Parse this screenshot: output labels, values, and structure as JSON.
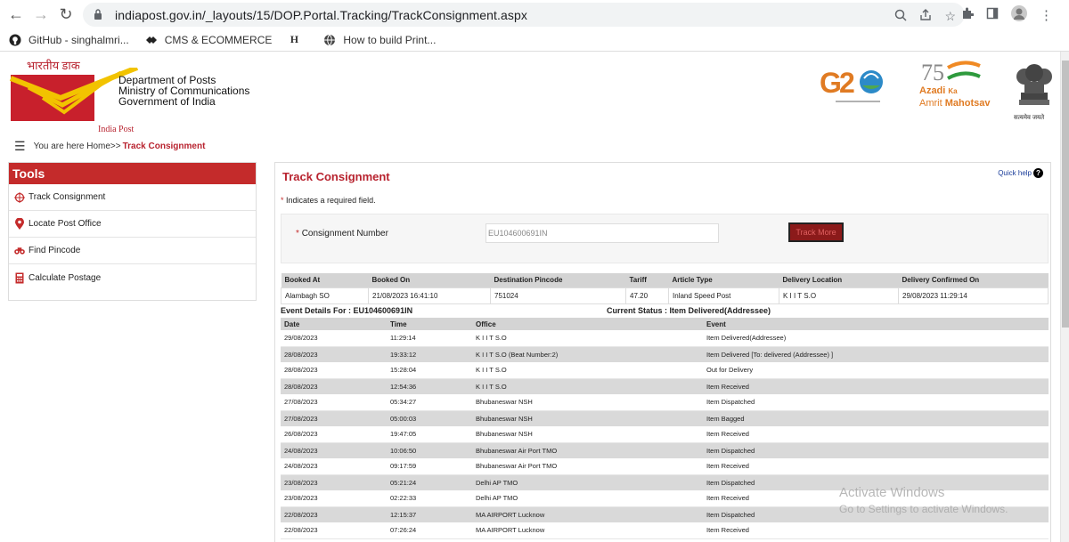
{
  "browser": {
    "url": "indiapost.gov.in/_layouts/15/DOP.Portal.Tracking/TrackConsignment.aspx",
    "bookmarks": [
      {
        "label": "GitHub - singhalmri...",
        "icon": "github-icon"
      },
      {
        "label": "CMS & ECOMMERCE",
        "icon": "bookmark-icon"
      },
      {
        "label": "",
        "icon": "h-icon"
      },
      {
        "label": "How to build Print...",
        "icon": "globe-icon"
      }
    ]
  },
  "header": {
    "logo_hindi": "भारतीय डाक",
    "logo_caption": "India Post",
    "dept_line1": "Department of Posts",
    "dept_line2": "Ministry of Communications",
    "dept_line3": "Government of India",
    "azadi_line1": "Azadi",
    "azadi_line2": "Ka",
    "azadi_line3": "Amrit",
    "azadi_line4": "Mahotsav",
    "emblem_caption": "सत्यमेव जयते"
  },
  "breadcrumb": {
    "prefix": "You are here Home>>",
    "current": "Track Consignment"
  },
  "sidebar": {
    "title": "Tools",
    "items": [
      {
        "label": "Track Consignment",
        "icon": "crosshair-icon"
      },
      {
        "label": "Locate Post Office",
        "icon": "map-pin-icon"
      },
      {
        "label": "Find Pincode",
        "icon": "binoculars-icon"
      },
      {
        "label": "Calculate Postage",
        "icon": "calculator-icon"
      }
    ]
  },
  "main": {
    "title": "Track Consignment",
    "quick_help": "Quick help",
    "required_note": "Indicates a required field.",
    "consignment_label": "Consignment Number",
    "consignment_value": "EU104600691IN",
    "track_more": "Track More"
  },
  "summary": {
    "headers": [
      "Booked At",
      "Booked On",
      "Destination Pincode",
      "Tariff",
      "Article Type",
      "Delivery Location",
      "Delivery Confirmed On"
    ],
    "row": [
      "Alambagh SO",
      "21/08/2023 16:41:10",
      "751024",
      "47.20",
      "Inland Speed Post",
      "K I I T S.O",
      "29/08/2023 11:29:14"
    ]
  },
  "events": {
    "details_for": "Event Details For : EU104600691IN",
    "current_status": "Current Status : Item Delivered(Addressee)",
    "headers": [
      "Date",
      "Time",
      "Office",
      "Event"
    ],
    "rows": [
      [
        "29/08/2023",
        "11:29:14",
        "K I I T S.O",
        "Item Delivered(Addressee)"
      ],
      [
        "28/08/2023",
        "19:33:12",
        "K I I T S.O (Beat Number:2)",
        "Item Delivered [To: delivered (Addressee) ]"
      ],
      [
        "28/08/2023",
        "15:28:04",
        "K I I T S.O",
        "Out for Delivery"
      ],
      [
        "28/08/2023",
        "12:54:36",
        "K I I T S.O",
        "Item Received"
      ],
      [
        "27/08/2023",
        "05:34:27",
        "Bhubaneswar NSH",
        "Item Dispatched"
      ],
      [
        "27/08/2023",
        "05:00:03",
        "Bhubaneswar NSH",
        "Item Bagged"
      ],
      [
        "26/08/2023",
        "19:47:05",
        "Bhubaneswar NSH",
        "Item Received"
      ],
      [
        "24/08/2023",
        "10:06:50",
        "Bhubaneswar Air Port TMO",
        "Item Dispatched"
      ],
      [
        "24/08/2023",
        "09:17:59",
        "Bhubaneswar Air Port TMO",
        "Item Received"
      ],
      [
        "23/08/2023",
        "05:21:24",
        "Delhi AP TMO",
        "Item Dispatched"
      ],
      [
        "23/08/2023",
        "02:22:33",
        "Delhi AP TMO",
        "Item Received"
      ],
      [
        "22/08/2023",
        "12:15:37",
        "MA AIRPORT Lucknow",
        "Item Dispatched"
      ],
      [
        "22/08/2023",
        "07:26:24",
        "MA AIRPORT Lucknow",
        "Item Received"
      ]
    ]
  },
  "watermark": {
    "line1": "Activate Windows",
    "line2": "Go to Settings to activate Windows."
  }
}
